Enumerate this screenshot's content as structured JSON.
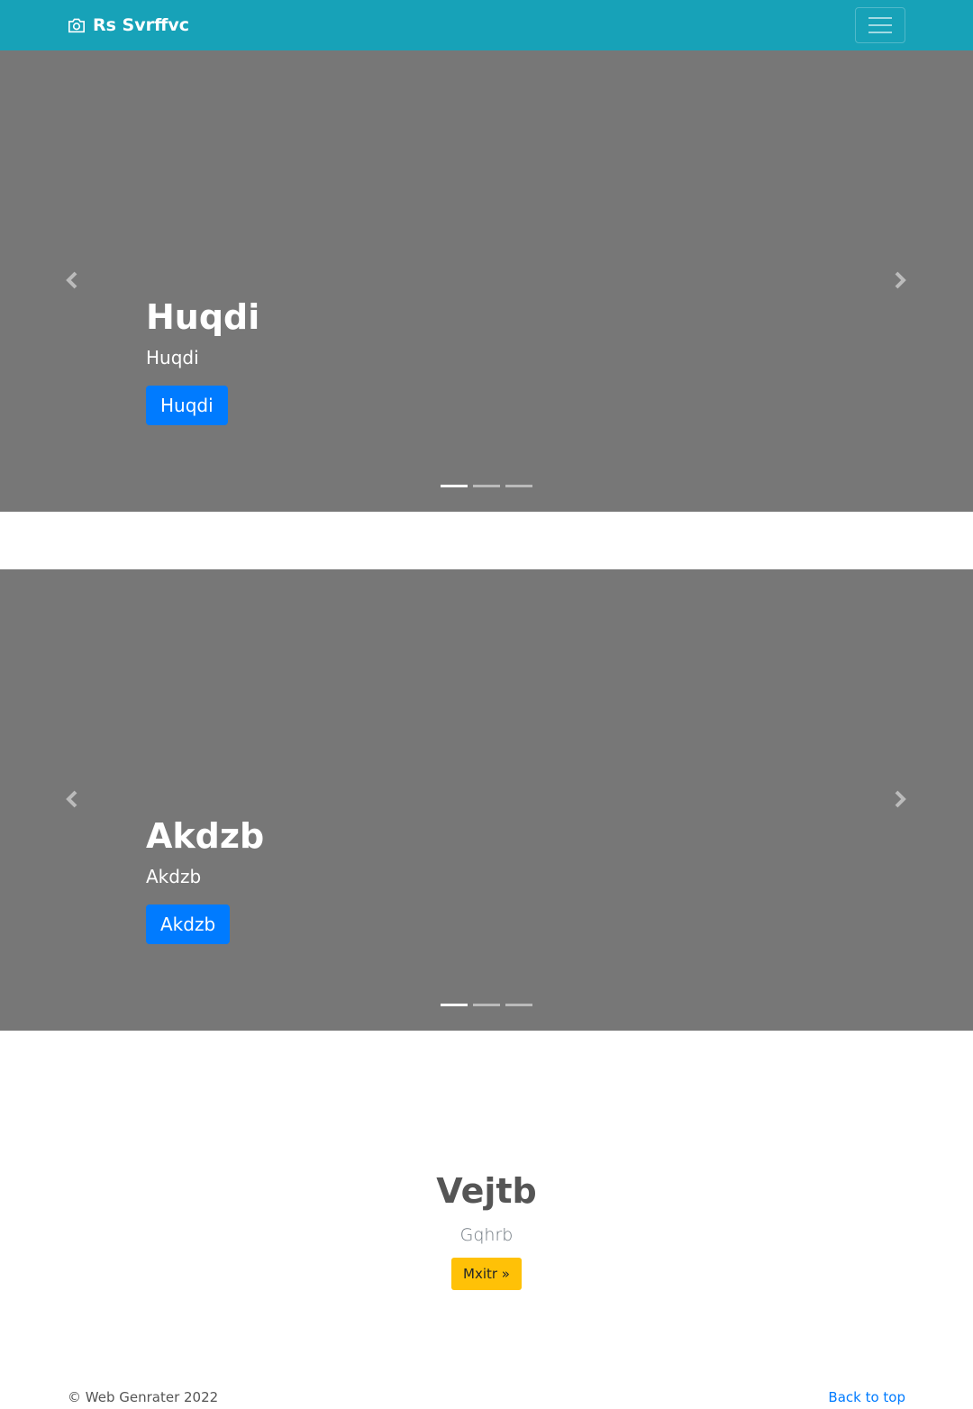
{
  "navbar": {
    "brand": "Rs Svrffvc",
    "brand_icon": "camera-icon",
    "toggler_icon": "hamburger-icon",
    "background": "#17a2b8"
  },
  "carousels": [
    {
      "title": "Huqdi",
      "subtitle": "Huqdi",
      "button": "Huqdi",
      "indicator_count": 3,
      "active_indicator": 0
    },
    {
      "title": "Akdzb",
      "subtitle": "Akdzb",
      "button": "Akdzb",
      "indicator_count": 3,
      "active_indicator": 0
    }
  ],
  "marketing": {
    "heading": "Vejtb",
    "text": "Gqhrb",
    "button": "Mxitr »"
  },
  "footer": {
    "copyright": "© Web Genrater 2022",
    "back_to_top": "Back to top"
  },
  "colors": {
    "primary": "#007bff",
    "warning": "#ffc107",
    "slide_bg": "#777777"
  }
}
